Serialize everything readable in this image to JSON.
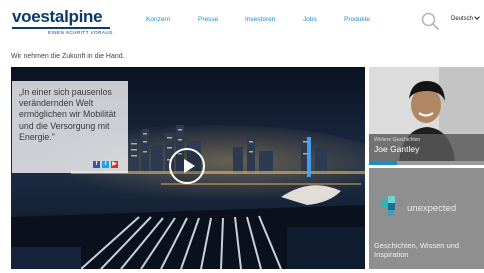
{
  "brand": {
    "name": "voestalpine",
    "tagline": "EINEN SCHRITT VORAUS.",
    "color": "#0a3a6e"
  },
  "nav": {
    "items": [
      "Konzern",
      "Presse",
      "Investoren",
      "Jobs",
      "Produkte"
    ],
    "color": "#1a8ec7"
  },
  "header": {
    "search_icon": "search-icon",
    "language": "Deutsch"
  },
  "page": {
    "tagline": "Wir nehmen die Zukunft in die Hand."
  },
  "hero": {
    "quote": "„In einer sich pausenlos verändernden Welt ermöglichen wir Mobilität und die Versorgung mit Energie.\"",
    "social": [
      "facebook-icon",
      "twitter-icon",
      "youtube-icon"
    ],
    "play_icon": "play-icon"
  },
  "story": {
    "kicker": "Weitere Geschichten",
    "name": "Joe Gantley",
    "progress": 0.24
  },
  "unexpected": {
    "title": "unexpected",
    "subtitle": "Geschichten, Wissen und Inspiration"
  }
}
